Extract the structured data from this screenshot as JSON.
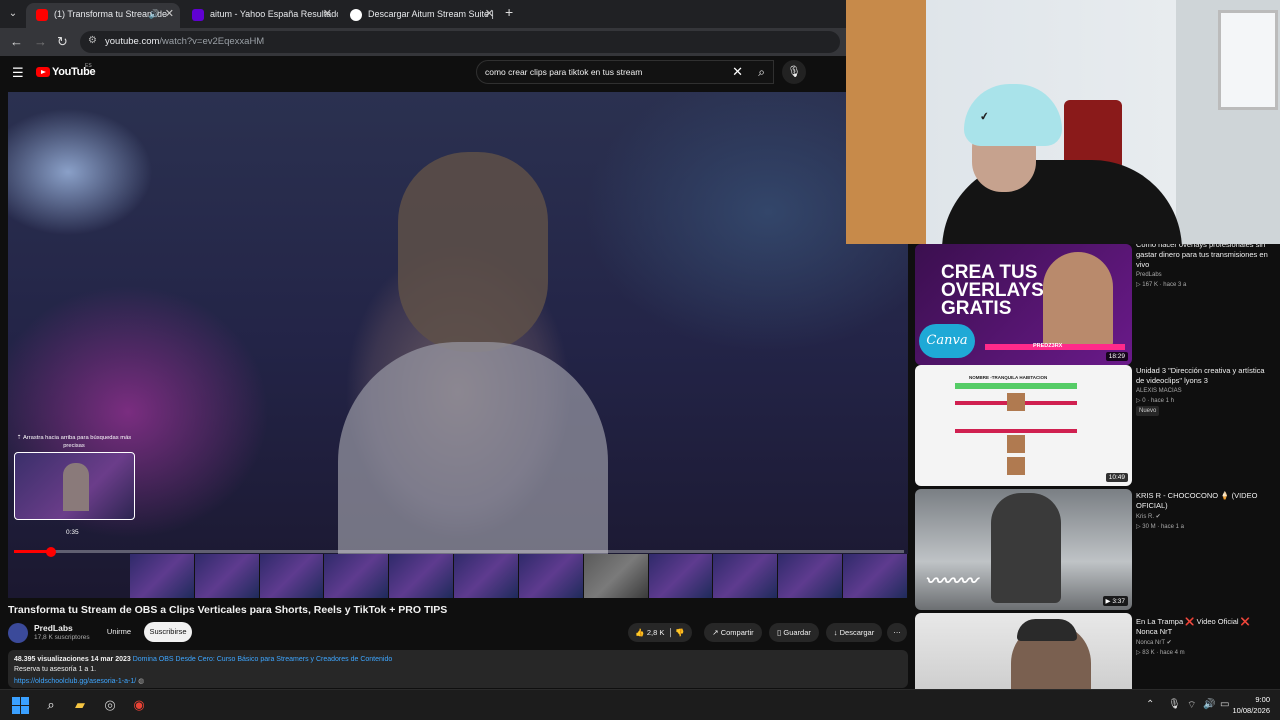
{
  "browser": {
    "tabs": [
      {
        "title": "(1) Transforma tu Stream de",
        "favicon_color": "#ff0000"
      },
      {
        "title": "aitum - Yahoo España Resultado",
        "favicon_color": "#6001d2"
      },
      {
        "title": "Descargar Aitum Stream Suite |",
        "favicon_color": "#ffffff"
      }
    ],
    "url_host": "youtube.com",
    "url_path": "/watch?v=ev2EqexxaHM"
  },
  "youtube": {
    "logo_text": "YouTube",
    "country": "ES",
    "search_value": "como crear clips para tiktok en tus stream"
  },
  "player": {
    "seek_hint": "Arrastra hacia arriba para búsquedas más precisas",
    "preview_time": "0:35",
    "progress_fraction": 0.042
  },
  "video": {
    "title": "Transforma tu Stream de OBS a Clips Verticales para Shorts, Reels y TikTok + PRO TIPS",
    "channel": "PredLabs",
    "subscribers": "17,8 K suscriptores",
    "join_label": "Unirme",
    "subscribe_label": "Suscribirse",
    "likes": "2,8 K",
    "share_label": "Compartir",
    "save_label": "Guardar",
    "download_label": "Descargar",
    "views": "48.395 visualizaciones",
    "date": "14 mar 2023",
    "desc_link": "Domina OBS Desde Cero: Curso Básico para Streamers y Creadores de Contenido",
    "desc_line2": "Reserva tu asesoría 1 a 1.",
    "desc_url": "https://oldschoolclub.gg/asesoria-1-a-1/"
  },
  "recommendations": [
    {
      "title": "Cómo hacer overlays profesionales sin gastar dinero para tus transmisiones en vivo",
      "channel": "PredLabs",
      "meta": "167 K · hace 3 a",
      "duration": "18:29",
      "thumb_text": "CREA TUS OVERLAYS GRATIS",
      "thumb_brand": "Canva",
      "thumb_tag": "PREDZ3RX"
    },
    {
      "title": "Unidad 3 \"Dirección creativa y artística de videoclips\" lyons 3",
      "channel": "ALEXIS MACIAS",
      "meta": "0 · hace 1 h",
      "badge": "Nuevo",
      "duration": "10:49",
      "thumb_text": "NOMBRE -TRANQUILA HABITACION"
    },
    {
      "title": "KRIS R - CHOCOCONO 🍦 (VIDEO OFICIAL)",
      "channel": "Kris R.",
      "meta": "30 M · hace 1 a",
      "duration": "3:37"
    },
    {
      "title": "En La Trampa ❌ Video Oficial ❌ Nonca NrT",
      "channel": "Nonca NrT",
      "meta": "83 K · hace 4 m"
    }
  ],
  "taskbar": {
    "time": "9:00",
    "date": "10/08/2026"
  }
}
